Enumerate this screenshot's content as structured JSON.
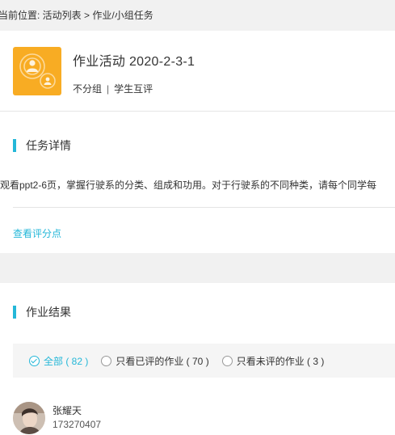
{
  "breadcrumb": {
    "prefix": "当前位置: ",
    "activity_list": "活动列表",
    "separator": " > ",
    "current": "作业/小组任务"
  },
  "activity": {
    "icon": "group-task-icon",
    "title": "作业活动 2020-2-3-1",
    "group_mode": "不分组",
    "separator": "|",
    "review_mode": "学生互评",
    "icon_color": "#f8ac23"
  },
  "detail": {
    "section_title": "任务详情",
    "text": "观看ppt2-6页，掌握行驶系的分类、组成和功用。对于行驶系的不同种类，请每个同学每",
    "score_link": "查看评分点"
  },
  "result": {
    "section_title": "作业结果",
    "filters": [
      {
        "label": "全部 ( 82 )",
        "selected": true
      },
      {
        "label": "只看已评的作业 ( 70 )",
        "selected": false
      },
      {
        "label": "只看未评的作业 ( 3 )",
        "selected": false
      }
    ],
    "students": [
      {
        "name": "张耀天",
        "id": "173270407"
      }
    ]
  },
  "colors": {
    "accent": "#24b7d8",
    "background": "#f1f1f1"
  }
}
